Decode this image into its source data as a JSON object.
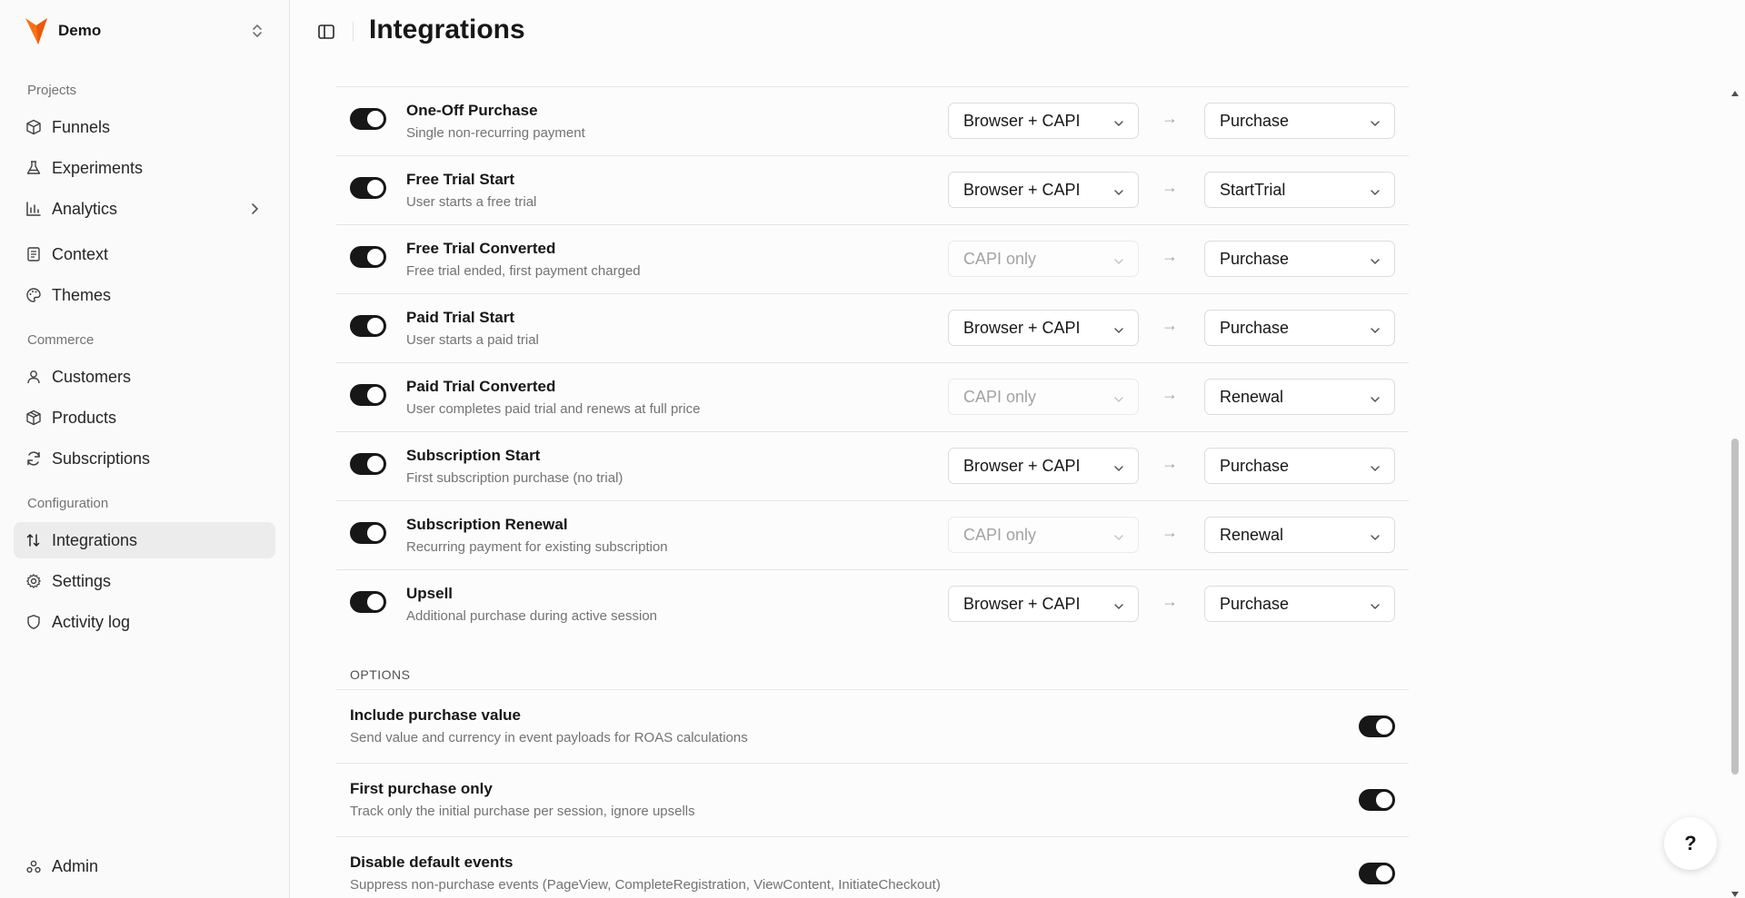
{
  "workspace": {
    "name": "Demo"
  },
  "sidebar": {
    "sections": [
      {
        "label": "Projects"
      },
      {
        "label": "Commerce"
      },
      {
        "label": "Configuration"
      }
    ],
    "items": [
      {
        "label": "Funnels",
        "icon": "box-icon"
      },
      {
        "label": "Experiments",
        "icon": "flask-icon"
      },
      {
        "label": "Analytics",
        "icon": "bar-chart-icon"
      },
      {
        "label": "Context",
        "icon": "document-icon"
      },
      {
        "label": "Themes",
        "icon": "palette-icon"
      },
      {
        "label": "Customers",
        "icon": "user-icon"
      },
      {
        "label": "Products",
        "icon": "package-icon"
      },
      {
        "label": "Subscriptions",
        "icon": "refresh-icon"
      },
      {
        "label": "Integrations",
        "icon": "arrows-up-down-icon",
        "active": true
      },
      {
        "label": "Settings",
        "icon": "gear-icon"
      },
      {
        "label": "Activity log",
        "icon": "shield-icon"
      }
    ],
    "admin": {
      "label": "Admin",
      "icon": "admin-icon"
    }
  },
  "header": {
    "title": "Integrations"
  },
  "events": [
    {
      "title": "One-Off Purchase",
      "desc": "Single non-recurring payment",
      "mode": "Browser + CAPI",
      "mode_disabled": false,
      "event": "Purchase",
      "enabled": true
    },
    {
      "title": "Free Trial Start",
      "desc": "User starts a free trial",
      "mode": "Browser + CAPI",
      "mode_disabled": false,
      "event": "StartTrial",
      "enabled": true
    },
    {
      "title": "Free Trial Converted",
      "desc": "Free trial ended, first payment charged",
      "mode": "CAPI only",
      "mode_disabled": true,
      "event": "Purchase",
      "enabled": true
    },
    {
      "title": "Paid Trial Start",
      "desc": "User starts a paid trial",
      "mode": "Browser + CAPI",
      "mode_disabled": false,
      "event": "Purchase",
      "enabled": true
    },
    {
      "title": "Paid Trial Converted",
      "desc": "User completes paid trial and renews at full price",
      "mode": "CAPI only",
      "mode_disabled": true,
      "event": "Renewal",
      "enabled": true
    },
    {
      "title": "Subscription Start",
      "desc": "First subscription purchase (no trial)",
      "mode": "Browser + CAPI",
      "mode_disabled": false,
      "event": "Purchase",
      "enabled": true
    },
    {
      "title": "Subscription Renewal",
      "desc": "Recurring payment for existing subscription",
      "mode": "CAPI only",
      "mode_disabled": true,
      "event": "Renewal",
      "enabled": true
    },
    {
      "title": "Upsell",
      "desc": "Additional purchase during active session",
      "mode": "Browser + CAPI",
      "mode_disabled": false,
      "event": "Purchase",
      "enabled": true
    }
  ],
  "arrow_glyph": "→",
  "options": {
    "label": "OPTIONS",
    "items": [
      {
        "title": "Include purchase value",
        "desc": "Send value and currency in event payloads for ROAS calculations",
        "enabled": true
      },
      {
        "title": "First purchase only",
        "desc": "Track only the initial purchase per session, ignore upsells",
        "enabled": true
      },
      {
        "title": "Disable default events",
        "desc": "Suppress non-purchase events (PageView, CompleteRegistration, ViewContent, InitiateCheckout)",
        "enabled": true
      }
    ]
  },
  "help": {
    "label": "?"
  },
  "colors": {
    "accent_logo": "#f97316",
    "toggle_on": "#171717",
    "active_nav_bg": "#ececec"
  }
}
